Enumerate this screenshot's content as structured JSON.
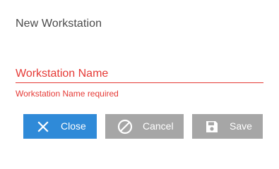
{
  "dialog": {
    "title": "New Workstation"
  },
  "form": {
    "workstation_name": {
      "placeholder": "Workstation Name",
      "value": "",
      "error": "Workstation Name required"
    }
  },
  "actions": {
    "close": {
      "label": "Close",
      "icon": "close-x-icon"
    },
    "cancel": {
      "label": "Cancel",
      "icon": "cancel-slash-icon"
    },
    "save": {
      "label": "Save",
      "icon": "floppy-disk-icon"
    }
  },
  "colors": {
    "primary": "#2f8ad8",
    "disabled": "#a6a6a6",
    "error": "#e53935",
    "title": "#4a4a4a"
  }
}
